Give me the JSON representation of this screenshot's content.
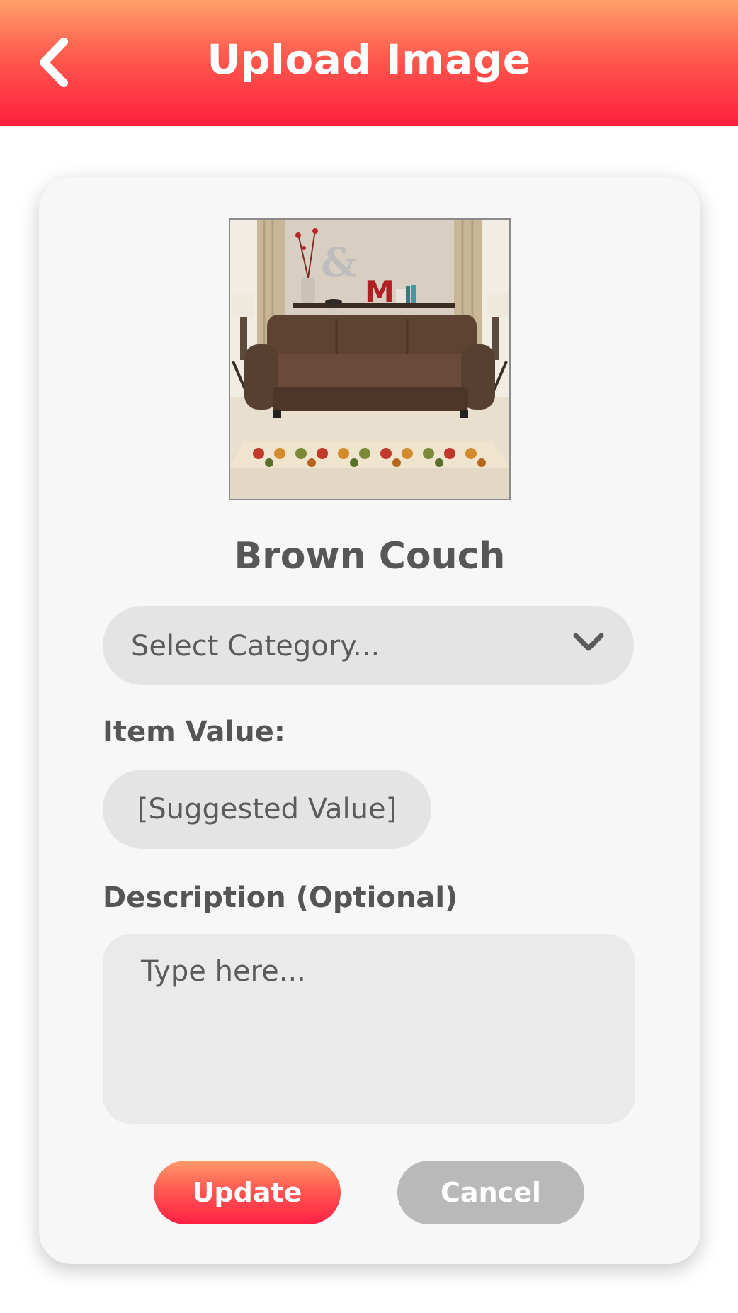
{
  "header": {
    "title": "Upload Image",
    "back_icon": "chevron-left-icon"
  },
  "item": {
    "name": "Brown Couch",
    "image_subject": "brown leather sofa in living room with patterned rug",
    "decor_letters": [
      "&",
      "M"
    ]
  },
  "category": {
    "placeholder": "Select Category...",
    "icon": "chevron-down-icon"
  },
  "item_value": {
    "label": "Item Value:",
    "value": "[Suggested Value]"
  },
  "description": {
    "label": "Description (Optional)",
    "placeholder": "Type here..."
  },
  "actions": {
    "update_label": "Update",
    "cancel_label": "Cancel"
  },
  "colors": {
    "accent_top": "#ffa06a",
    "accent_bottom": "#ff1f3d",
    "field_bg": "#e4e4e5",
    "cancel_bg": "#b9b9ba"
  }
}
